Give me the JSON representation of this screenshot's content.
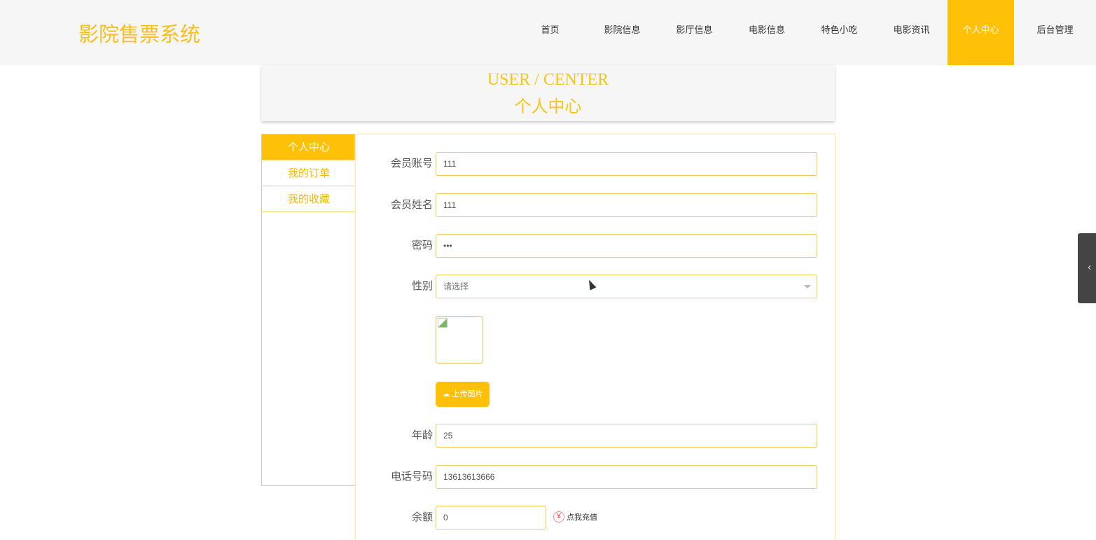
{
  "header": {
    "logo": "影院售票系统",
    "nav": [
      {
        "label": "首页"
      },
      {
        "label": "影院信息"
      },
      {
        "label": "影厅信息"
      },
      {
        "label": "电影信息"
      },
      {
        "label": "特色小吃"
      },
      {
        "label": "电影资讯"
      },
      {
        "label": "个人中心",
        "active": true
      },
      {
        "label": "后台管理"
      }
    ]
  },
  "banner": {
    "en": "USER / CENTER",
    "cn": "个人中心"
  },
  "sidebar": {
    "items": [
      {
        "label": "个人中心"
      },
      {
        "label": "我的订单"
      },
      {
        "label": "我的收藏"
      }
    ]
  },
  "form": {
    "account": {
      "label": "会员账号",
      "value": "111"
    },
    "name": {
      "label": "会员姓名",
      "value": "111"
    },
    "password": {
      "label": "密码",
      "value": "•••"
    },
    "gender": {
      "label": "性别",
      "placeholder": "请选择"
    },
    "upload_label": "上传图片",
    "age": {
      "label": "年龄",
      "value": "25"
    },
    "phone": {
      "label": "电话号码",
      "value": "13613613666"
    },
    "balance": {
      "label": "余额",
      "value": "0"
    },
    "recharge_label": "点我充值"
  }
}
